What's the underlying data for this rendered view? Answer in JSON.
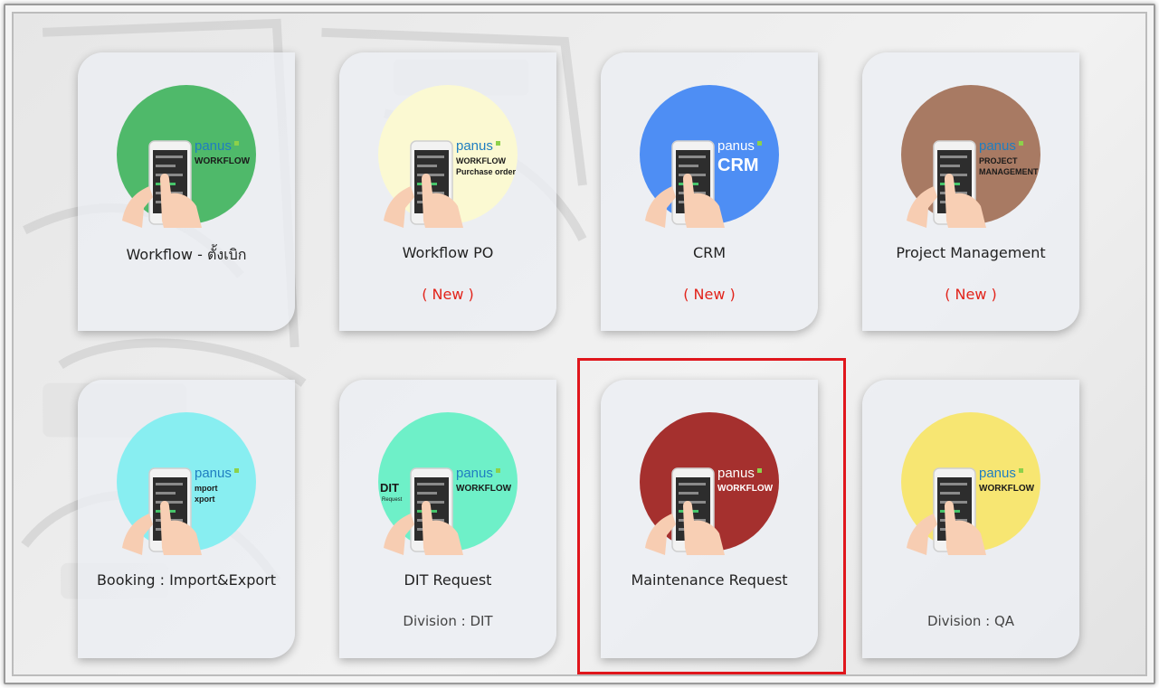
{
  "cards": [
    {
      "title": "Workflow - ตั้งเบิก",
      "subtitle": "",
      "circle_color": "#4fb96a",
      "logo": "panus",
      "logo_line1": "WORKFLOW",
      "logo_line2": "",
      "logo_style": "plain"
    },
    {
      "title": "Workflow PO",
      "subtitle": "( New )",
      "circle_color": "#fbf9d2",
      "logo": "panus",
      "logo_line1": "WORKFLOW",
      "logo_line2": "Purchase order",
      "logo_style": "bold"
    },
    {
      "title": "CRM",
      "subtitle": "( New )",
      "circle_color": "#4e8ef4",
      "logo": "panus",
      "logo_line1": "CRM",
      "logo_line2": "",
      "logo_style": "big"
    },
    {
      "title": "Project Management",
      "subtitle": "( New )",
      "circle_color": "#a87a63",
      "logo": "panus",
      "logo_line1": "PROJECT",
      "logo_line2": "MANAGEMENT",
      "logo_style": "bold"
    },
    {
      "title": "Booking : Import&Export",
      "subtitle": "",
      "circle_color": "#88eef1",
      "logo": "panus",
      "logo_line1": "mport",
      "logo_line2": "xport",
      "logo_style": "bold"
    },
    {
      "title": "DIT Request",
      "subtitle": "Division : DIT",
      "circle_color": "#6ef0c8",
      "logo": "panus",
      "logo_line1": "WORKFLOW",
      "logo_line2": "",
      "logo_style": "plain",
      "side_label": "DIT",
      "side_sub": "Request"
    },
    {
      "title": "Maintenance Request",
      "subtitle": "",
      "circle_color": "#a5302e",
      "logo": "panus",
      "logo_line1": "WORKFLOW",
      "logo_line2": "",
      "logo_style": "plain"
    },
    {
      "title": "",
      "subtitle": "Division : QA",
      "circle_color": "#f7e672",
      "logo": "panus",
      "logo_line1": "WORKFLOW",
      "logo_line2": "",
      "logo_style": "plain"
    }
  ],
  "icons": {
    "art": "hands-holding-phone-icon",
    "brand": "panus-logo-icon"
  },
  "colors": {
    "card_bg": "#eceef3",
    "highlight": "#e0161c",
    "new_text": "#e2231a"
  }
}
